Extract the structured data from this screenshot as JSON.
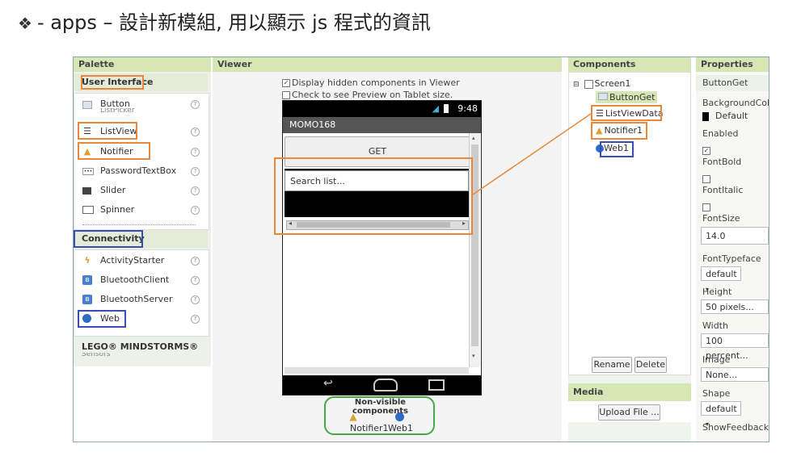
{
  "heading": {
    "bullet": "❖",
    "text": "- apps – 設計新模組, 用以顯示 js 程式的資訊"
  },
  "columns": {
    "palette": "Palette",
    "viewer": "Viewer",
    "components": "Components",
    "properties": "Properties"
  },
  "palette": {
    "user_interface": "User Interface",
    "partial_top": "ListPicker",
    "ui_items": [
      {
        "label": "Button"
      },
      {
        "label": "ListView"
      },
      {
        "label": "Notifier"
      },
      {
        "label": "PasswordTextBox"
      },
      {
        "label": "Slider"
      },
      {
        "label": "Spinner"
      }
    ],
    "connectivity": "Connectivity",
    "conn_items": [
      {
        "label": "ActivityStarter"
      },
      {
        "label": "BluetoothClient"
      },
      {
        "label": "BluetoothServer"
      },
      {
        "label": "Web"
      }
    ],
    "lego": "LEGO® MINDSTORMS®",
    "partial_bottom": "Sensors",
    "help": "?"
  },
  "viewer": {
    "display_hidden": "Display hidden components in Viewer",
    "tablet_preview": "Check to see Preview on Tablet size.",
    "status_time": "9:48",
    "app_title": "MOMO168",
    "get_button": "GET",
    "search_placeholder": "Search list...",
    "nonvisible_title": "Non-visible components",
    "nonvisible_items": [
      "Notifier1",
      "Web1"
    ]
  },
  "components": {
    "screen": "Screen1",
    "items": [
      "ButtonGet",
      "ListViewData",
      "Notifier1",
      "Web1"
    ],
    "rename": "Rename",
    "delete": "Delete",
    "media": "Media",
    "upload": "Upload File ..."
  },
  "properties": {
    "selected": "ButtonGet",
    "background_color": "BackgroundColo",
    "background_value": "Default",
    "enabled": "Enabled",
    "font_bold": "FontBold",
    "font_italic": "FontItalic",
    "font_size": "FontSize",
    "font_size_value": "14.0",
    "font_typeface": "FontTypeface",
    "font_typeface_value": "default",
    "height": "Height",
    "height_value": "50 pixels...",
    "width": "Width",
    "width_value": "100 percent...",
    "image": "Image",
    "image_value": "None...",
    "shape": "Shape",
    "shape_value": "default",
    "show_feedback": "ShowFeedback",
    "check_mark": "✓",
    "dropdown_arrow": "▾"
  },
  "colors": {
    "header_bg": "#d6e6b5",
    "orange": "#e9873a",
    "blue": "#3b4cb5",
    "green": "#45a845",
    "phone_bar": "#555555",
    "phone_black": "#000000"
  }
}
